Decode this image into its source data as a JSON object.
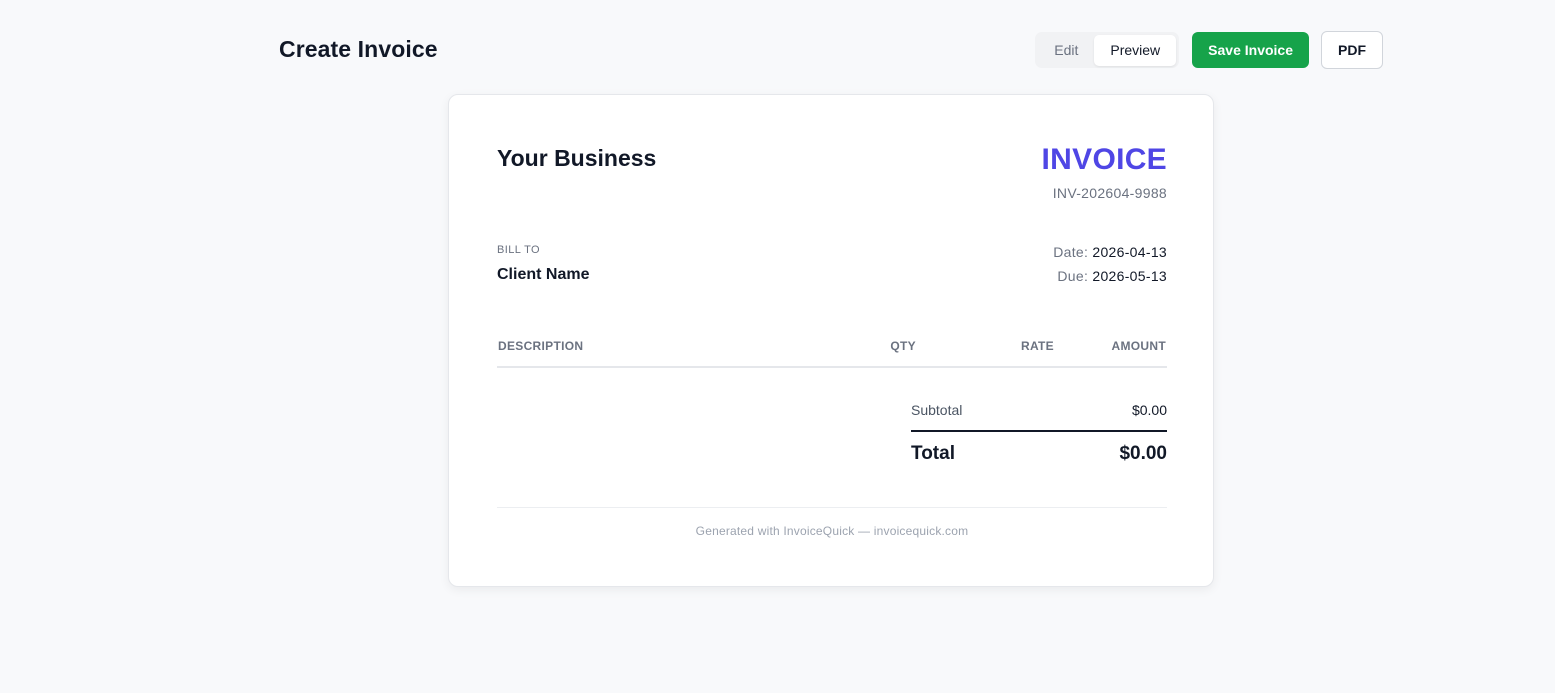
{
  "header": {
    "title": "Create Invoice",
    "mode_toggle": {
      "edit_label": "Edit",
      "preview_label": "Preview",
      "active": "Preview"
    },
    "save_label": "Save Invoice",
    "pdf_label": "PDF",
    "save_color": "#16a34a"
  },
  "invoice": {
    "business_name": "Your Business",
    "title": "INVOICE",
    "title_color": "#4f46e5",
    "number": "INV-202604-9988",
    "bill_to_label": "BILL TO",
    "client_name": "Client Name",
    "date_label": "Date:",
    "date_value": "2026-04-13",
    "due_label": "Due:",
    "due_value": "2026-05-13",
    "columns": [
      "DESCRIPTION",
      "QTY",
      "RATE",
      "AMOUNT"
    ],
    "line_items": [],
    "subtotal_label": "Subtotal",
    "subtotal_value": "$0.00",
    "total_label": "Total",
    "total_value": "$0.00",
    "footer": "Generated with InvoiceQuick — invoicequick.com"
  }
}
